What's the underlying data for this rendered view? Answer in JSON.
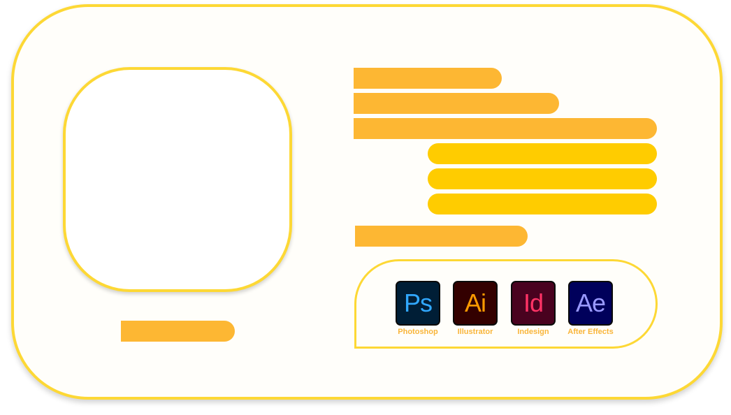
{
  "colors": {
    "border": "#fdd835",
    "bar_orange": "#fdb733",
    "bar_yellow": "#ffcc00",
    "label": "#f9b53a"
  },
  "skills": {
    "apps": [
      {
        "icon": "photoshop-icon",
        "abbr": "Ps",
        "label": "Photoshop"
      },
      {
        "icon": "illustrator-icon",
        "abbr": "Ai",
        "label": "Illustrator"
      },
      {
        "icon": "indesign-icon",
        "abbr": "Id",
        "label": "Indesign"
      },
      {
        "icon": "after-effects-icon",
        "abbr": "Ae",
        "label": "After Effects"
      }
    ]
  }
}
